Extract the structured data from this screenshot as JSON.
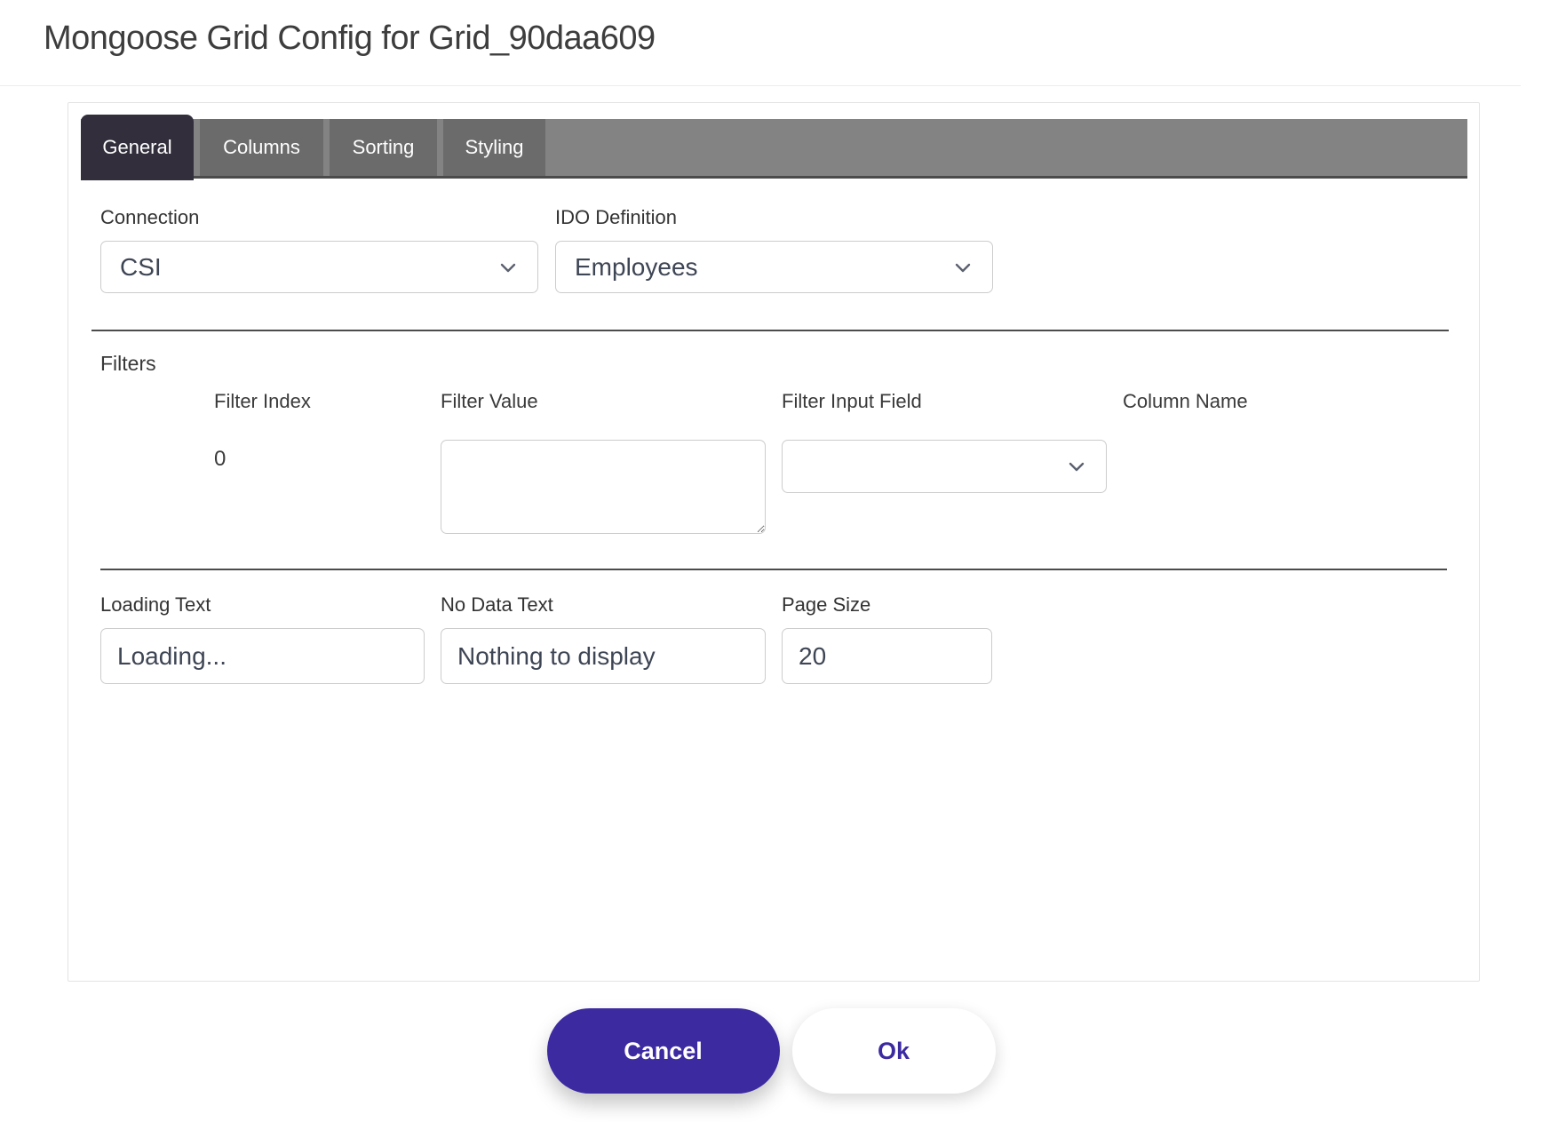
{
  "title": "Mongoose Grid Config for Grid_90daa609",
  "tabs": [
    {
      "label": "General",
      "active": true
    },
    {
      "label": "Columns",
      "active": false
    },
    {
      "label": "Sorting",
      "active": false
    },
    {
      "label": "Styling",
      "active": false
    }
  ],
  "general": {
    "connection": {
      "label": "Connection",
      "value": "CSI"
    },
    "ido_definition": {
      "label": "IDO Definition",
      "value": "Employees"
    },
    "filters": {
      "section_label": "Filters",
      "columns": {
        "index": "Filter Index",
        "value": "Filter Value",
        "input_field": "Filter Input Field",
        "column_name": "Column Name"
      },
      "row": {
        "index": "0",
        "value": "",
        "input_field": "",
        "column_name": ""
      }
    },
    "loading_text": {
      "label": "Loading Text",
      "value": "Loading..."
    },
    "no_data_text": {
      "label": "No Data Text",
      "value": "Nothing to display"
    },
    "page_size": {
      "label": "Page Size",
      "value": "20"
    }
  },
  "actions": {
    "cancel": "Cancel",
    "ok": "Ok"
  },
  "colors": {
    "accent_purple": "#3c2aa0",
    "active_tab": "#322e3c",
    "inactive_tab": "#6b6b6b",
    "tab_bar": "#838383",
    "divider_dark": "#4c4c4c",
    "input_border": "#cccccc",
    "input_text": "#3e4554"
  }
}
